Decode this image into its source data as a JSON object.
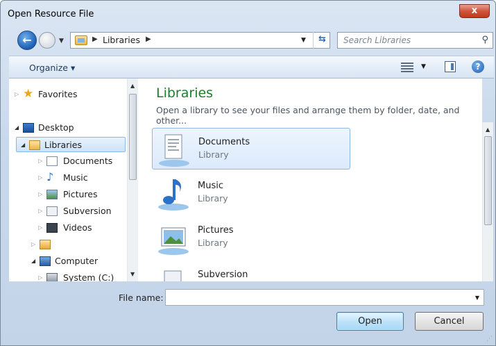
{
  "window": {
    "title": "Open Resource File",
    "close_label": "x"
  },
  "address": {
    "crumb": "Libraries",
    "sep_icon": "chevron-right-icon"
  },
  "search": {
    "placeholder": "Search Libraries"
  },
  "toolbar": {
    "organize_label": "Organize"
  },
  "nav": {
    "items": [
      {
        "label": "Favorites",
        "icon": "star-icon"
      },
      {
        "label": "Desktop",
        "icon": "desktop-icon"
      },
      {
        "label": "Libraries",
        "icon": "libraries-icon"
      },
      {
        "label": "Documents",
        "icon": "documents-icon"
      },
      {
        "label": "Music",
        "icon": "music-icon"
      },
      {
        "label": "Pictures",
        "icon": "pictures-icon"
      },
      {
        "label": "Subversion",
        "icon": "subversion-icon"
      },
      {
        "label": "Videos",
        "icon": "videos-icon"
      },
      {
        "label": "",
        "icon": "user-folder-icon"
      },
      {
        "label": "Computer",
        "icon": "computer-icon"
      },
      {
        "label": "System (C:)",
        "icon": "drive-icon"
      }
    ]
  },
  "content": {
    "heading": "Libraries",
    "description": "Open a library to see your files and arrange them by folder, date, and other...",
    "libraries": [
      {
        "name": "Documents",
        "type": "Library"
      },
      {
        "name": "Music",
        "type": "Library"
      },
      {
        "name": "Pictures",
        "type": "Library"
      },
      {
        "name": "Subversion",
        "type": ""
      }
    ]
  },
  "footer": {
    "filename_label": "File name:",
    "filename_value": "",
    "open_label": "Open",
    "cancel_label": "Cancel"
  },
  "colors": {
    "heading_green": "#1a7e2c",
    "selection_blue": "#cde3f9",
    "close_red": "#c0391e"
  }
}
